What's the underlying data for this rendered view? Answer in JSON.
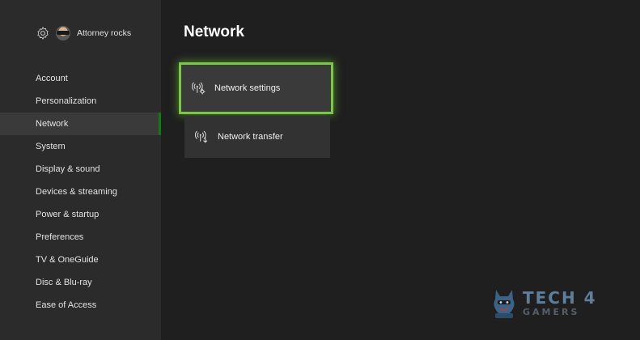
{
  "profile": {
    "gamertag": "Attorney rocks",
    "settings_icon": "gear-icon"
  },
  "sidebar": {
    "items": [
      {
        "label": "Account"
      },
      {
        "label": "Personalization"
      },
      {
        "label": "Network",
        "active": true
      },
      {
        "label": "System"
      },
      {
        "label": "Display & sound"
      },
      {
        "label": "Devices & streaming"
      },
      {
        "label": "Power & startup"
      },
      {
        "label": "Preferences"
      },
      {
        "label": "TV & OneGuide"
      },
      {
        "label": "Disc & Blu-ray"
      },
      {
        "label": "Ease of Access"
      }
    ]
  },
  "main": {
    "title": "Network",
    "tiles": [
      {
        "label": "Network settings",
        "icon": "network-settings-icon",
        "focused": true
      },
      {
        "label": "Network transfer",
        "icon": "network-transfer-icon",
        "focused": false
      }
    ]
  },
  "watermark": {
    "line1": "TECH 4",
    "line2": "GAMERS"
  },
  "colors": {
    "accent": "#107c10",
    "focus_glow": "#7ac943",
    "sidebar_bg": "#2b2b2b",
    "main_bg": "#1f1f1f",
    "tile_bg": "#323232"
  }
}
